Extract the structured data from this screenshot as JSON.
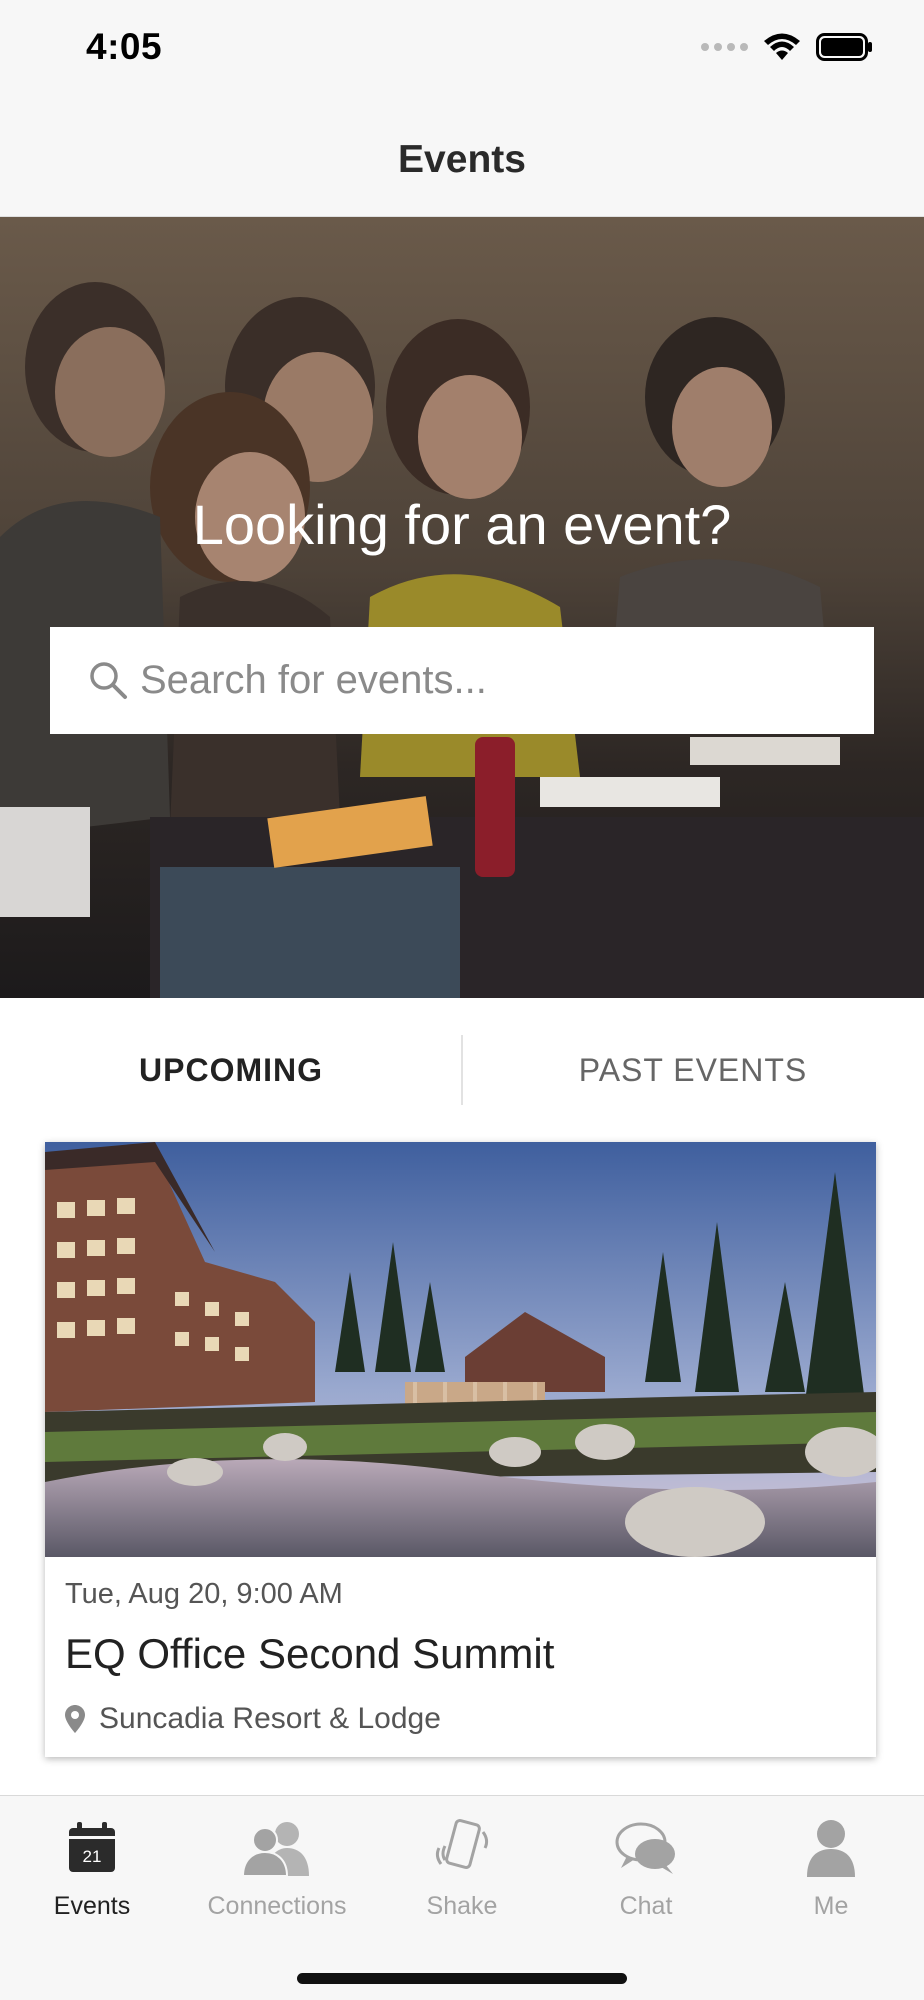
{
  "status_bar": {
    "time": "4:05",
    "icons": [
      "signal-dots-icon",
      "wifi-icon",
      "battery-icon"
    ]
  },
  "nav": {
    "title": "Events"
  },
  "hero": {
    "title": "Looking for an event?",
    "search": {
      "placeholder": "Search for events...",
      "value": "",
      "icon": "search-icon"
    }
  },
  "tabs": {
    "upcoming": "UPCOMING",
    "past": "PAST EVENTS",
    "selected": "upcoming"
  },
  "events": [
    {
      "date": "Tue, Aug 20, 9:00 AM",
      "title": "EQ Office Second Summit",
      "location": "Suncadia Resort & Lodge",
      "image": "resort-lodge-with-pond"
    }
  ],
  "tab_bar": {
    "items": [
      {
        "label": "Events",
        "icon": "calendar-icon",
        "icon_text": "21",
        "active": true
      },
      {
        "label": "Connections",
        "icon": "people-icon",
        "active": false
      },
      {
        "label": "Shake",
        "icon": "phone-shake-icon",
        "active": false
      },
      {
        "label": "Chat",
        "icon": "chat-bubbles-icon",
        "active": false
      },
      {
        "label": "Me",
        "icon": "person-icon",
        "active": false
      }
    ]
  },
  "colors": {
    "background": "#ffffff",
    "bars": "#f7f7f7",
    "active_label": "#222222",
    "inactive_label": "#a3a3a3"
  }
}
